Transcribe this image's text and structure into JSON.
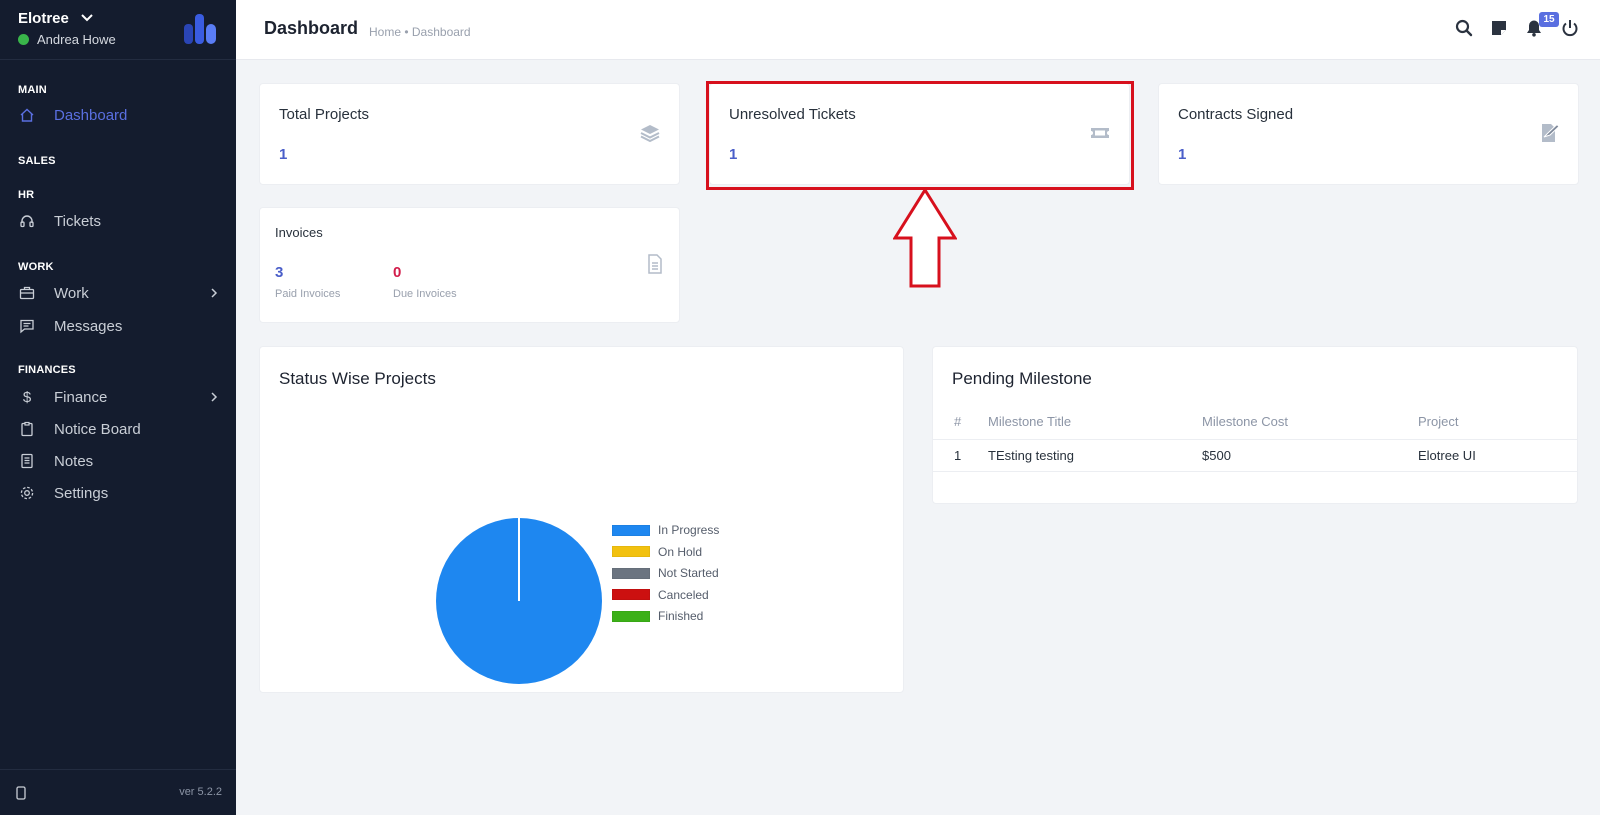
{
  "sidebar": {
    "brand_name": "Elotree",
    "user_name": "Andrea Howe",
    "sections": {
      "main": "MAIN",
      "sales": "SALES",
      "hr": "HR",
      "work": "WORK",
      "finances": "FINANCES"
    },
    "items": {
      "dashboard": "Dashboard",
      "tickets": "Tickets",
      "work": "Work",
      "messages": "Messages",
      "finance": "Finance",
      "notice_board": "Notice Board",
      "notes": "Notes",
      "settings": "Settings"
    },
    "version": "ver 5.2.2"
  },
  "header": {
    "title": "Dashboard",
    "breadcrumb": "Home • Dashboard",
    "notification_count": "15"
  },
  "stats": {
    "total_projects": {
      "title": "Total Projects",
      "value": "1"
    },
    "unresolved_tickets": {
      "title": "Unresolved Tickets",
      "value": "1"
    },
    "contracts_signed": {
      "title": "Contracts Signed",
      "value": "1"
    }
  },
  "invoices": {
    "title": "Invoices",
    "paid_value": "3",
    "paid_label": "Paid Invoices",
    "due_value": "0",
    "due_label": "Due Invoices"
  },
  "status_panel": {
    "title": "Status Wise Projects"
  },
  "chart_data": {
    "type": "pie",
    "categories": [
      "In Progress",
      "On Hold",
      "Not Started",
      "Canceled",
      "Finished"
    ],
    "values": [
      1,
      0,
      0,
      0,
      0
    ],
    "colors": [
      "#1e87f0",
      "#f2c10f",
      "#6b7480",
      "#cc1010",
      "#3cb018"
    ],
    "legend": "right"
  },
  "milestone": {
    "title": "Pending Milestone",
    "columns": [
      "#",
      "Milestone Title",
      "Milestone Cost",
      "Project"
    ],
    "rows": [
      [
        "1",
        "TEsting testing",
        "$500",
        "Elotree UI"
      ]
    ]
  },
  "colors": {
    "accent": "#5a6fe0",
    "sidebar_bg": "#141c2e",
    "highlight": "#d7101d",
    "due": "#d21c4a"
  }
}
